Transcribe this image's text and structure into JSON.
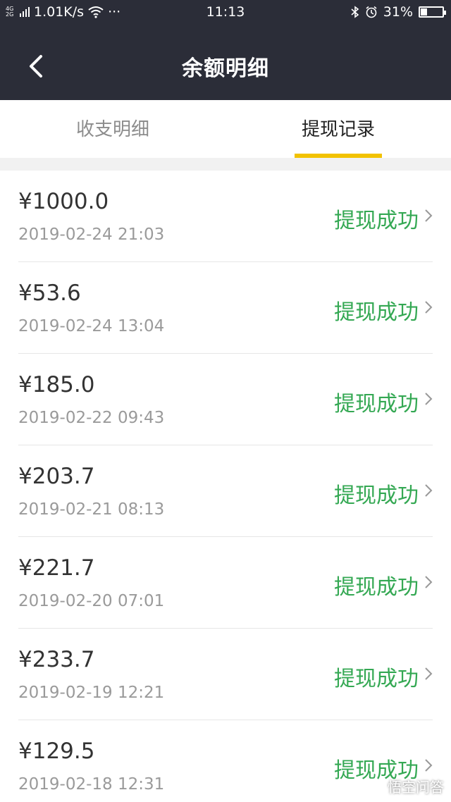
{
  "status_bar": {
    "network_tag_top": "4G",
    "network_tag_bottom": "2G",
    "speed": "1.01K/s",
    "more": "···",
    "time": "11:13",
    "battery": "31%",
    "battery_level": 0.31
  },
  "header": {
    "title": "余额明细"
  },
  "tabs": [
    {
      "label": "收支明细",
      "active": false
    },
    {
      "label": "提现记录",
      "active": true
    }
  ],
  "records": [
    {
      "amount": "¥1000.0",
      "date": "2019-02-24 21:03",
      "status": "提现成功"
    },
    {
      "amount": "¥53.6",
      "date": "2019-02-24 13:04",
      "status": "提现成功"
    },
    {
      "amount": "¥185.0",
      "date": "2019-02-22 09:43",
      "status": "提现成功"
    },
    {
      "amount": "¥203.7",
      "date": "2019-02-21 08:13",
      "status": "提现成功"
    },
    {
      "amount": "¥221.7",
      "date": "2019-02-20 07:01",
      "status": "提现成功"
    },
    {
      "amount": "¥233.7",
      "date": "2019-02-19 12:21",
      "status": "提现成功"
    },
    {
      "amount": "¥129.5",
      "date": "2019-02-18 12:31",
      "status": "提现成功"
    }
  ],
  "watermark": "悟空问答",
  "colors": {
    "header_bg": "#2b2d38",
    "accent_underline": "#f2c200",
    "success_green": "#34a853"
  }
}
